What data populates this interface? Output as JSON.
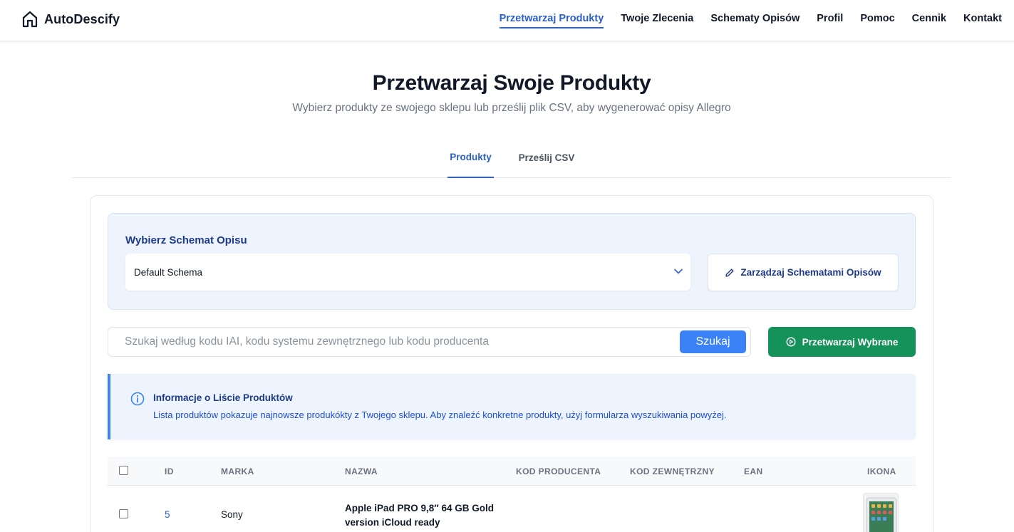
{
  "brand": {
    "name": "AutoDescify",
    "icon": "home-icon"
  },
  "nav": {
    "items": [
      {
        "label": "Przetwarzaj Produkty",
        "active": true
      },
      {
        "label": "Twoje Zlecenia"
      },
      {
        "label": "Schematy Opisów"
      },
      {
        "label": "Profil"
      },
      {
        "label": "Pomoc"
      },
      {
        "label": "Cennik"
      },
      {
        "label": "Kontakt"
      }
    ]
  },
  "hero": {
    "title": "Przetwarzaj Swoje Produkty",
    "subtitle": "Wybierz produkty ze swojego sklepu lub prześlij plik CSV, aby wygenerować opisy Allegro"
  },
  "tabs": [
    {
      "label": "Produkty",
      "active": true
    },
    {
      "label": "Prześlij CSV"
    }
  ],
  "schema": {
    "label": "Wybierz Schemat Opisu",
    "selected": "Default Schema",
    "manage_label": "Zarządzaj Schematami Opisów"
  },
  "search": {
    "placeholder": "Szukaj według kodu IAI, kodu systemu zewnętrznego lub kodu producenta",
    "button_label": "Szukaj",
    "process_label": "Przetwarzaj Wybrane"
  },
  "info": {
    "title": "Informacje o Liście Produktów",
    "text": "Lista produktów pokazuje najnowsze produkókty z Twojego sklepu. Aby znaleźć konkretne produkty, użyj formularza wyszukiwania powyżej."
  },
  "table": {
    "headers": {
      "id": "ID",
      "brand": "MARKA",
      "name": "NAZWA",
      "producer_code": "KOD PRODUCENTA",
      "external_code": "KOD ZEWNĘTRZNY",
      "ean": "EAN",
      "icon": "IKONA"
    },
    "rows": [
      {
        "id": "5",
        "brand": "Sony",
        "name": "Apple iPad PRO 9,8″ 64 GB Gold version iCloud ready",
        "producer_code": "",
        "external_code": "",
        "ean": ""
      }
    ]
  },
  "colors": {
    "accent": "#2b5fc4",
    "success": "#15915a",
    "search_button": "#3b82f6",
    "info_bg": "#eef4fd"
  }
}
